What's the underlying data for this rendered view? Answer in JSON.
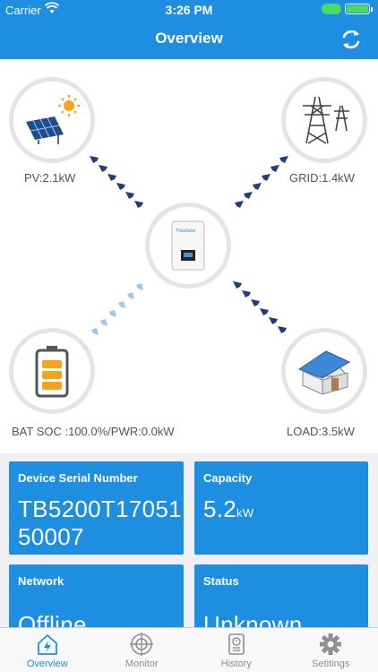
{
  "status_bar": {
    "carrier": "Carrier",
    "time": "3:26 PM",
    "battery_level": 1.0
  },
  "nav": {
    "title": "Overview"
  },
  "diagram": {
    "pv_label": "PV:2.1kW",
    "grid_label": "GRID:1.4kW",
    "battery_label": "BAT SOC :100.0%/PWR:0.0kW",
    "load_label": "LOAD:3.5kW",
    "inverter_brand": "TrinaSolar"
  },
  "cards": {
    "serial": {
      "title": "Device Serial Number",
      "value_line1": "TB5200T17051",
      "value_line2": "50007"
    },
    "capacity": {
      "title": "Capacity",
      "value": "5.2",
      "unit": "kW"
    },
    "network": {
      "title": "Network",
      "value": "Offline"
    },
    "status": {
      "title": "Status",
      "value": "Unknown"
    }
  },
  "tabs": [
    {
      "label": "Overview",
      "active": true
    },
    {
      "label": "Monitor",
      "active": false
    },
    {
      "label": "History",
      "active": false
    },
    {
      "label": "Setitings",
      "active": false
    }
  ],
  "colors": {
    "primary": "#1e8fe0",
    "arrow_dark": "#1f3f7a",
    "arrow_light": "#9cc8f0"
  }
}
